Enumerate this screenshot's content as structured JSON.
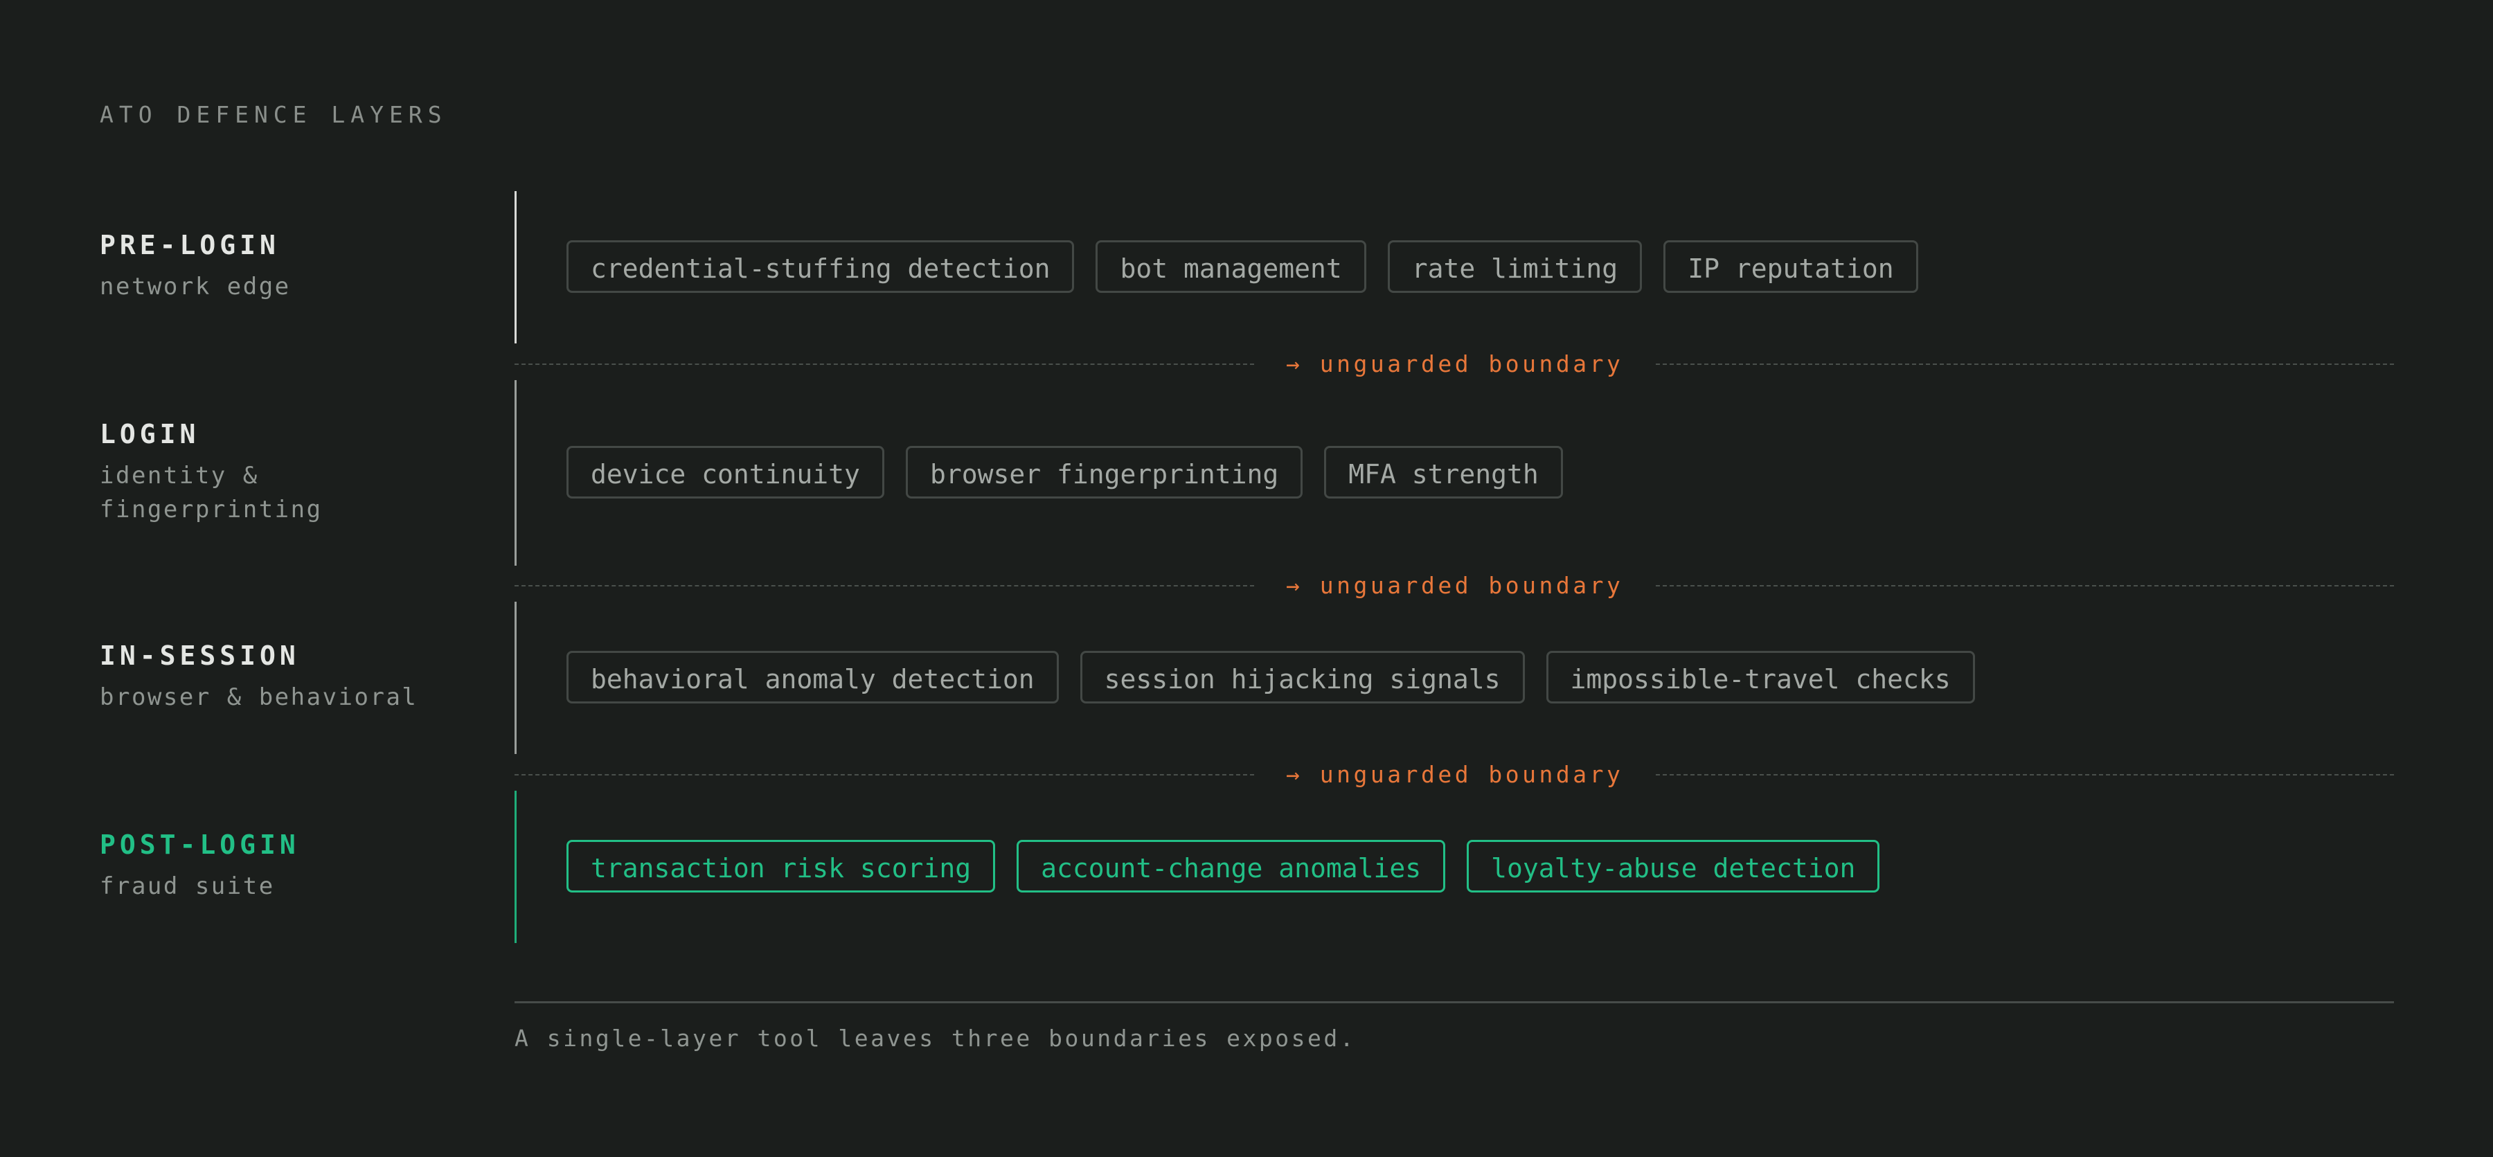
{
  "heading": "ATO DEFENCE LAYERS",
  "layers": [
    {
      "title": "PRE-LOGIN",
      "subtitle": "network edge",
      "chips": [
        "credential-stuffing detection",
        "bot management",
        "rate limiting",
        "IP reputation"
      ]
    },
    {
      "title": "LOGIN",
      "subtitle": "identity & fingerprinting",
      "chips": [
        "device continuity",
        "browser fingerprinting",
        "MFA strength"
      ]
    },
    {
      "title": "IN-SESSION",
      "subtitle": "browser & behavioral",
      "chips": [
        "behavioral anomaly detection",
        "session hijacking signals",
        "impossible-travel checks"
      ]
    },
    {
      "title": "POST-LOGIN",
      "subtitle": "fraud suite",
      "chips": [
        "transaction risk scoring",
        "account-change anomalies",
        "loyalty-abuse detection"
      ]
    }
  ],
  "boundaries": [
    {
      "arrow": "→",
      "label": "unguarded boundary"
    },
    {
      "arrow": "→",
      "label": "unguarded boundary"
    },
    {
      "arrow": "→",
      "label": "unguarded boundary"
    }
  ],
  "footnote": "A single-layer tool leaves three boundaries exposed.",
  "colors": {
    "background": "#1b1e1c",
    "accent_green": "#22bf86",
    "boundary_orange": "#e8773a"
  }
}
